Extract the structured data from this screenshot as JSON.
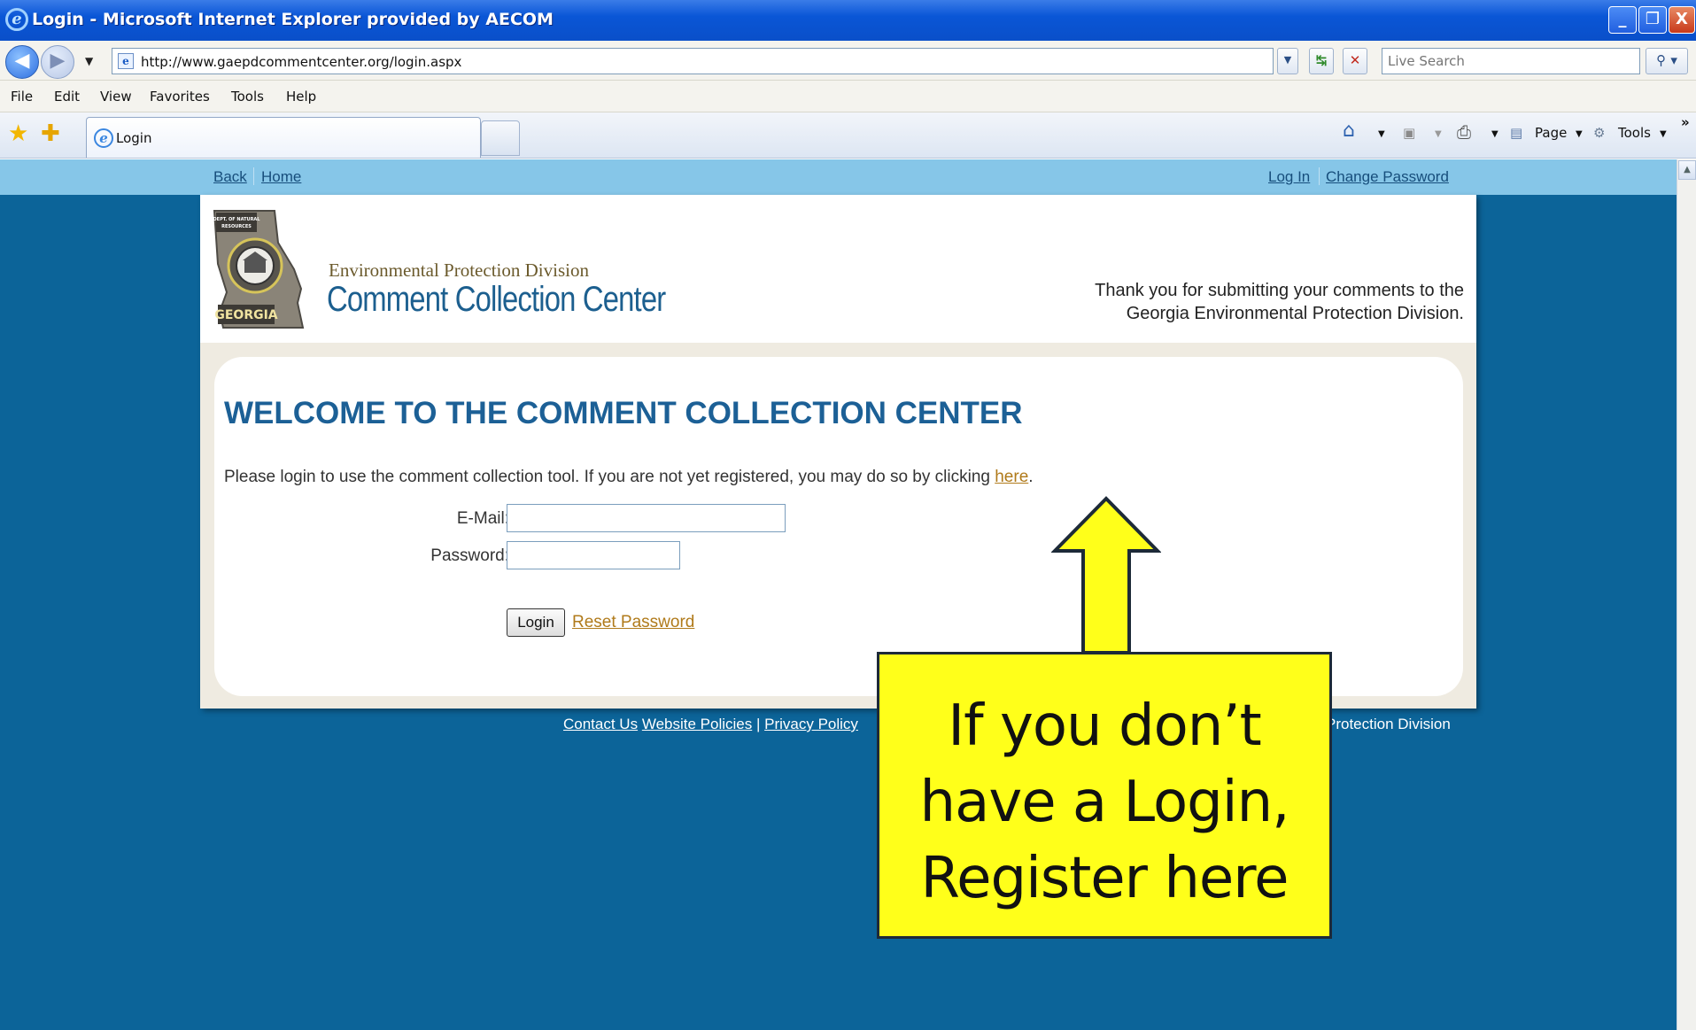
{
  "window": {
    "title": "Login - Microsoft Internet Explorer provided by AECOM",
    "buttons": [
      "_",
      "❐",
      "X"
    ]
  },
  "address_bar": {
    "url": "http://www.gaepdcommentcenter.org/login.aspx",
    "search_placeholder": "Live Search"
  },
  "menu": [
    "File",
    "Edit",
    "View",
    "Favorites",
    "Tools",
    "Help"
  ],
  "tab": {
    "label": "Login"
  },
  "command_bar": {
    "page_label": "Page",
    "tools_label": "Tools",
    "more": "»"
  },
  "site_nav": {
    "left": [
      "Back",
      "Home"
    ],
    "right": [
      "Log In",
      "Change Password"
    ]
  },
  "header": {
    "seal_top": "DEPT. OF NATURAL RESOURCES",
    "seal_bottom": "GEORGIA",
    "division": "Environmental Protection Division",
    "app_name": "Comment Collection Center",
    "thanks_line1": "Thank you for submitting your comments to the",
    "thanks_line2": "Georgia Environmental Protection Division."
  },
  "login": {
    "heading": "WELCOME TO THE COMMENT COLLECTION CENTER",
    "intro": "Please login to use the comment collection tool. If you are not yet registered, you may do so by clicking ",
    "intro_link": "here",
    "intro_end": ".",
    "email_label": "E-Mail:",
    "email_value": "",
    "password_label": "Password:",
    "password_value": "",
    "login_button": "Login",
    "reset_link": "Reset Password"
  },
  "footer": {
    "contact": "Contact Us",
    "policies": "Website Policies",
    "sep": "|",
    "privacy": "Privacy Policy",
    "division_partial": "Protection Division"
  },
  "callout": {
    "line1": "If you don’t",
    "line2": "have a Login,",
    "line3": "Register here"
  },
  "colors": {
    "page_bg": "#0c6499",
    "nav_bg": "#86c6e8",
    "heading": "#1c6096",
    "link": "#b07a1a",
    "callout": "#ffff1a"
  }
}
